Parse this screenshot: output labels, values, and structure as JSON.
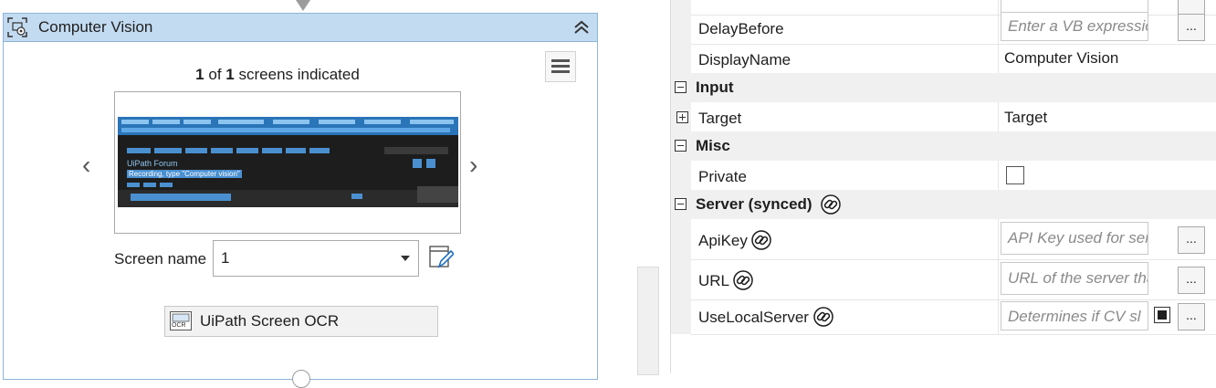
{
  "activity": {
    "title": "Computer Vision",
    "screens": {
      "current": "1",
      "of": "of",
      "total": "1",
      "suffix": "screens indicated"
    },
    "screen_name_label": "Screen name",
    "screen_name_value": "1",
    "ocr_engine": "UiPath Screen OCR",
    "ocr_badge": "OCR",
    "thumbnail": {
      "logo_text": "UiPath Forum",
      "recording_text": "Recording, type \"Computer vision\""
    }
  },
  "properties": {
    "rows": [
      {
        "name": "DelayBefore",
        "placeholder": "Enter a VB expression"
      },
      {
        "name": "DisplayName",
        "value": "Computer Vision"
      }
    ],
    "categories": {
      "input": "Input",
      "misc": "Misc",
      "server": "Server (synced)"
    },
    "input_rows": [
      {
        "name": "Target",
        "value": "Target"
      }
    ],
    "misc_rows": [
      {
        "name": "Private"
      }
    ],
    "server_rows": [
      {
        "name": "ApiKey",
        "placeholder": "API Key used for server"
      },
      {
        "name": "URL",
        "placeholder": "URL of the server that p"
      },
      {
        "name": "UseLocalServer",
        "placeholder": "Determines if CV sl"
      }
    ],
    "ellipsis": "..."
  },
  "colors": {
    "header": "#c3dbf1",
    "border": "#8fb4d6",
    "category": "#f0f0f0"
  }
}
